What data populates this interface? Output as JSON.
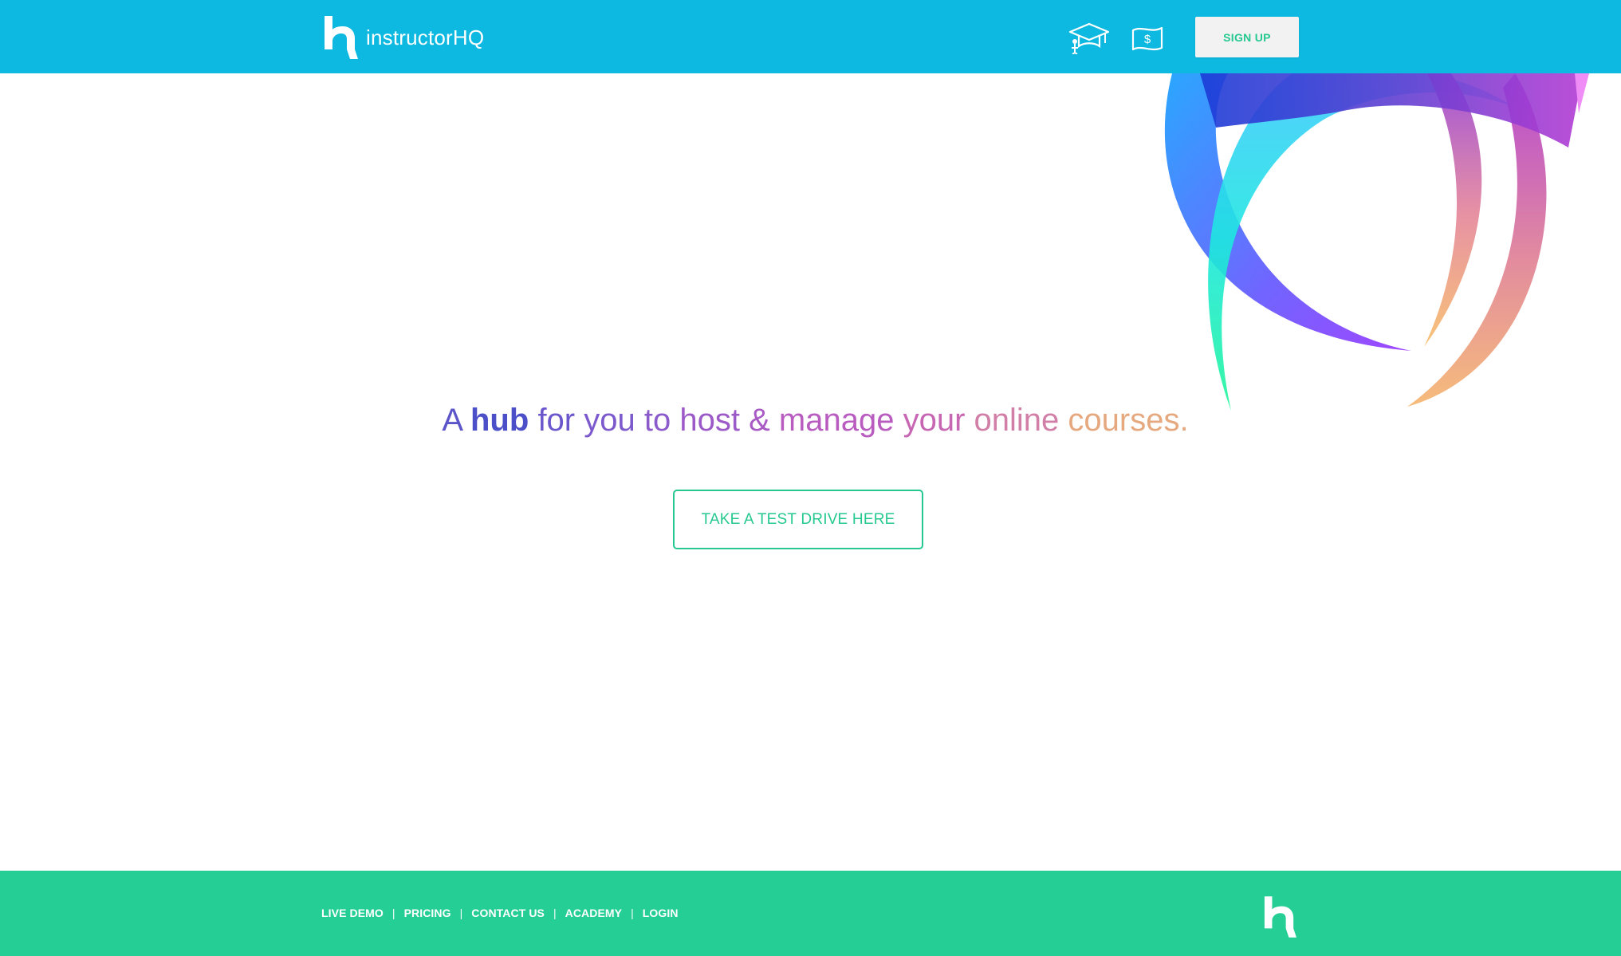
{
  "header": {
    "brand_name": "instructorHQ",
    "icons": [
      {
        "name": "academy-icon"
      },
      {
        "name": "pricing-icon"
      }
    ],
    "signup_label": "SIGN UP"
  },
  "hero": {
    "tagline_words": [
      {
        "text": "A",
        "color": "#5b55c9"
      },
      {
        "text": "hub",
        "color": "#4b4fc8",
        "bold": true
      },
      {
        "text": "for",
        "color": "#6b57cb"
      },
      {
        "text": "you",
        "color": "#7c59cc"
      },
      {
        "text": "to",
        "color": "#8b5acb"
      },
      {
        "text": "host",
        "color": "#9b5ac8"
      },
      {
        "text": "&",
        "color": "#a95bc5"
      },
      {
        "text": "manage",
        "color": "#b95cc0"
      },
      {
        "text": "your",
        "color": "#c766b3"
      },
      {
        "text": "online",
        "color": "#d27fa8"
      },
      {
        "text": "courses.",
        "color": "#e6a97f"
      }
    ],
    "cta_label": "TAKE A TEST DRIVE HERE"
  },
  "footer": {
    "links": [
      "LIVE DEMO",
      "PRICING",
      "CONTACT US",
      "ACADEMY",
      "LOGIN"
    ],
    "separator": "|"
  },
  "colors": {
    "header_bg": "#0db9e0",
    "footer_bg": "#25ce95",
    "accent_green": "#25c990",
    "signup_bg": "#f2f2f2"
  }
}
